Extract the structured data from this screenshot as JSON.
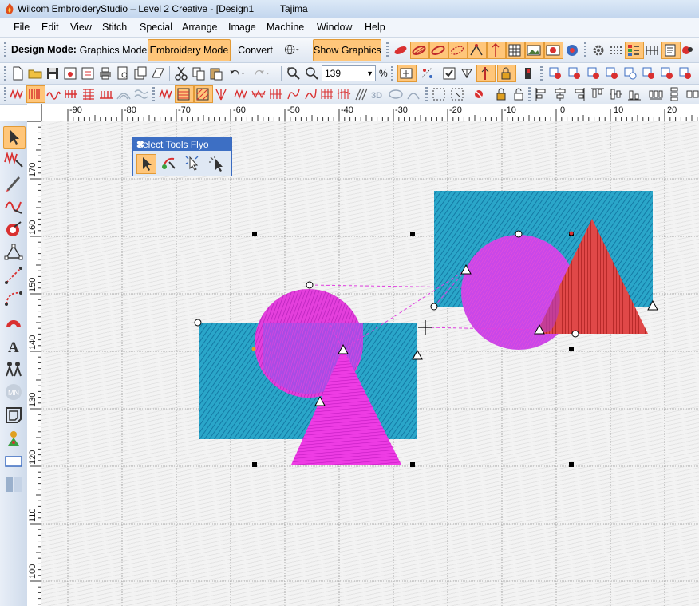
{
  "window": {
    "title": "Wilcom EmbroideryStudio – Level 2 Creative - [Design1",
    "machine": "Tajima"
  },
  "menu": [
    "File",
    "Edit",
    "View",
    "Stitch",
    "Special",
    "Arrange",
    "Image",
    "Machine",
    "Window",
    "Help"
  ],
  "modebar": {
    "design_mode_label": "Design Mode:",
    "graphics_mode": "Graphics Mode",
    "embroidery_mode": "Embroidery Mode",
    "convert": "Convert",
    "show_graphics": "Show Graphics"
  },
  "zoom": {
    "value": "139",
    "unit": "%"
  },
  "ruler": {
    "top_labels": [
      "-90",
      "-80",
      "-70",
      "-60",
      "-50",
      "-40",
      "-30",
      "-20",
      "-10",
      "0",
      "10",
      "20"
    ],
    "left_labels": [
      "170",
      "160",
      "150",
      "140",
      "130",
      "120",
      "110",
      "100"
    ]
  },
  "flyout": {
    "title": "Select Tools Flyo",
    "close": "✖"
  },
  "colors": {
    "accent_orange": "#ffc67a",
    "fill_blue": "#1da0c8",
    "fill_magenta": "#e93ae0",
    "fill_red": "#e03a3a",
    "fill_purple": "#9a4de8"
  },
  "icons": {
    "left_toolbox": [
      "select-arrow-icon",
      "zigzag-stitch-icon",
      "pen-icon",
      "satin-icon",
      "reshape-icon",
      "node-icon",
      "run-line-icon",
      "curve-icon",
      "arc-fill-icon",
      "lettering-icon",
      "figures-icon",
      "monogram-icon",
      "outline-icon",
      "appliqué-icon",
      "rectangle-icon",
      "transform-icon"
    ]
  }
}
